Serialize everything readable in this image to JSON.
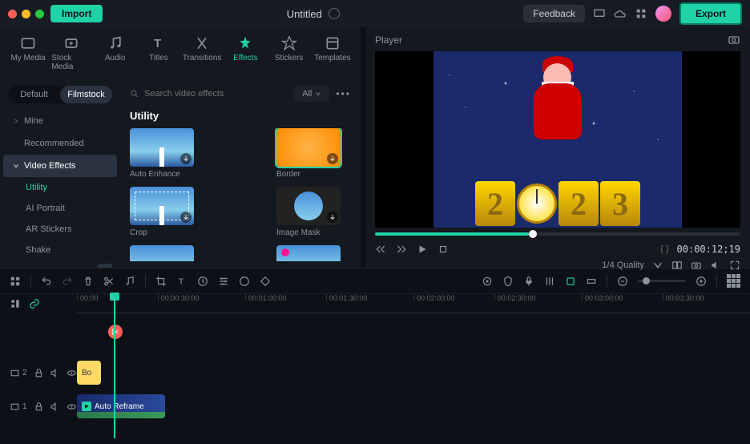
{
  "topbar": {
    "import": "Import",
    "title": "Untitled",
    "feedback": "Feedback",
    "export": "Export"
  },
  "mediaTabs": [
    {
      "label": "My Media"
    },
    {
      "label": "Stock Media"
    },
    {
      "label": "Audio"
    },
    {
      "label": "Titles"
    },
    {
      "label": "Transitions"
    },
    {
      "label": "Effects"
    },
    {
      "label": "Stickers"
    },
    {
      "label": "Templates"
    }
  ],
  "tabSwitch": {
    "default": "Default",
    "filmstock": "Filmstock"
  },
  "sidebar": {
    "mine": "Mine",
    "recommended": "Recommended",
    "videoEffects": "Video Effects",
    "subs": [
      {
        "label": "Utility"
      },
      {
        "label": "AI Portrait"
      },
      {
        "label": "AR Stickers"
      },
      {
        "label": "Shake"
      }
    ]
  },
  "search": {
    "placeholder": "Search video effects",
    "filter": "All"
  },
  "section": "Utility",
  "effects": [
    {
      "label": "Auto Enhance"
    },
    {
      "label": "Border"
    },
    {
      "label": "Crop"
    },
    {
      "label": "Image Mask"
    },
    {
      "label": ""
    },
    {
      "label": ""
    }
  ],
  "player": {
    "title": "Player",
    "timecode": "00:00:12;19",
    "quality": "1/4 Quality",
    "markers": "{    }"
  },
  "ruler": [
    "00:00",
    "00:00:30:00",
    "00:01:00:00",
    "00:01:30:00",
    "00:02:00:00",
    "00:02:30:00",
    "00:03:00:00",
    "00:03:30:00"
  ],
  "tracks": {
    "t2": "2",
    "t1": "1",
    "clipBorder": "Bo",
    "clipVideo": "Auto Reframe"
  }
}
